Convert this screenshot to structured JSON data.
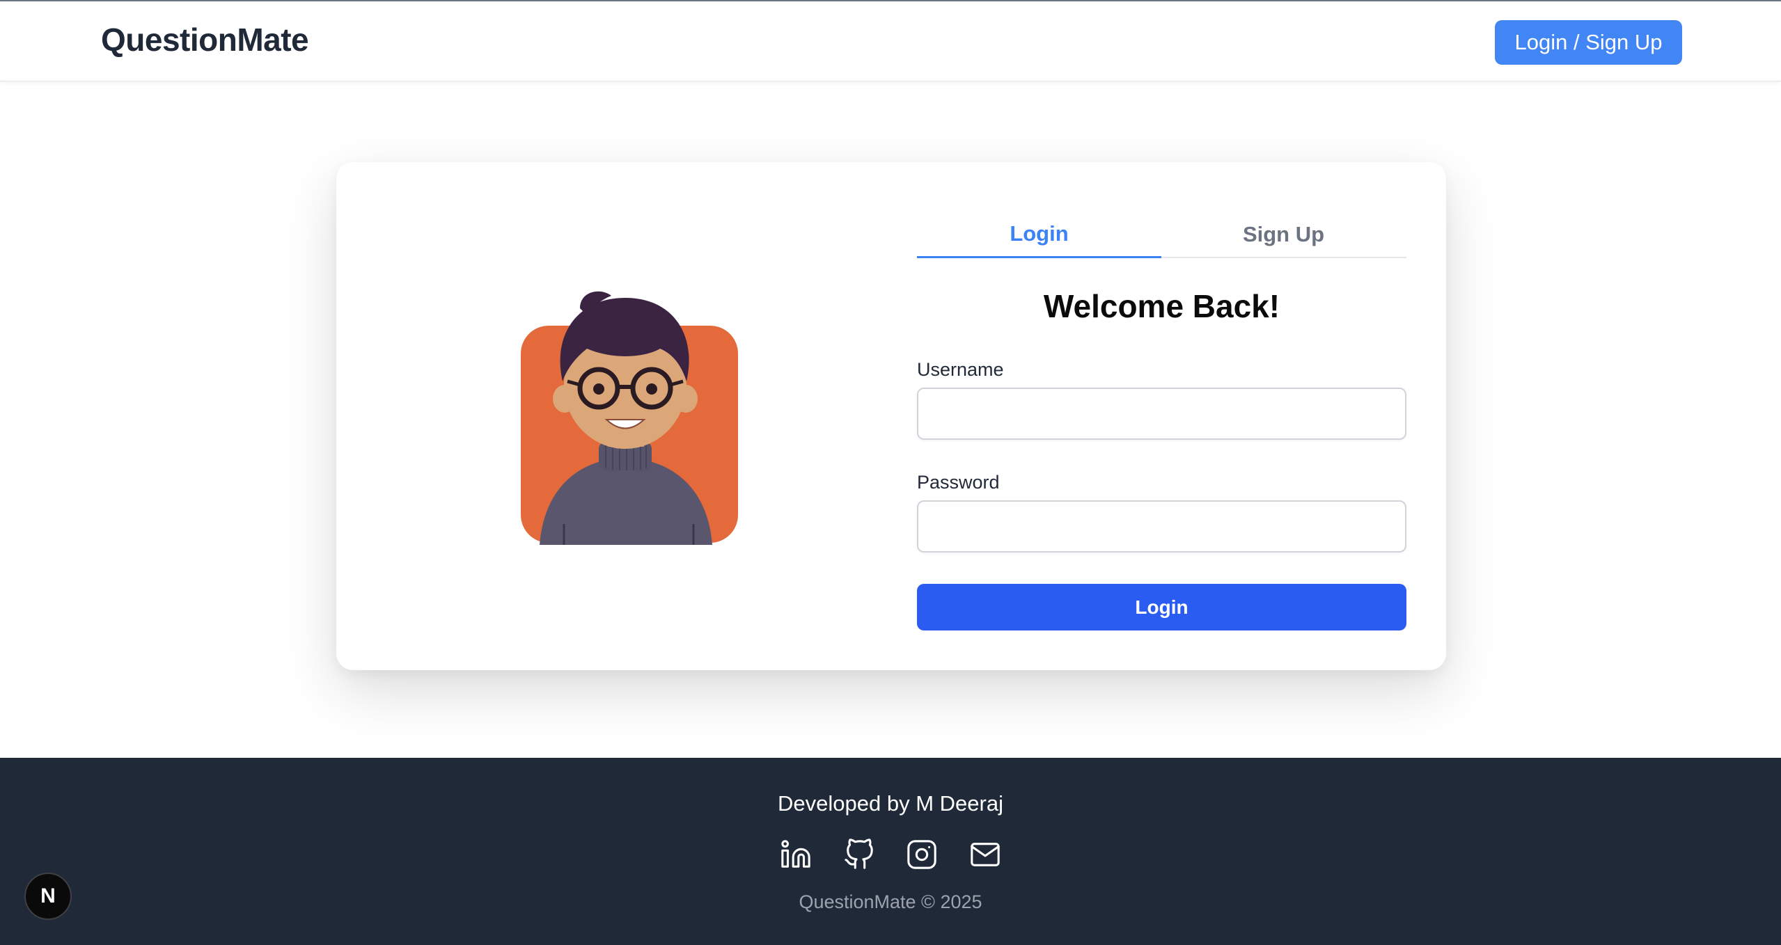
{
  "header": {
    "brand": "QuestionMate",
    "auth_button": "Login / Sign Up"
  },
  "tabs": [
    {
      "label": "Login",
      "active": true
    },
    {
      "label": "Sign Up",
      "active": false
    }
  ],
  "form": {
    "title": "Welcome Back!",
    "username_label": "Username",
    "username_value": "",
    "password_label": "Password",
    "password_value": "",
    "submit_label": "Login"
  },
  "footer": {
    "developer": "Developed by M Deeraj",
    "copyright": "QuestionMate © 2025",
    "socials": [
      {
        "icon": "linkedin-icon"
      },
      {
        "icon": "github-icon"
      },
      {
        "icon": "instagram-icon"
      },
      {
        "icon": "mail-icon"
      }
    ]
  },
  "dev_badge": "N",
  "colors": {
    "primary": "#4285f4",
    "submit": "#2b5cf2",
    "tab_active": "#3b82f6",
    "footer_bg": "#1f2937",
    "avatar_bg": "#e4693b"
  }
}
